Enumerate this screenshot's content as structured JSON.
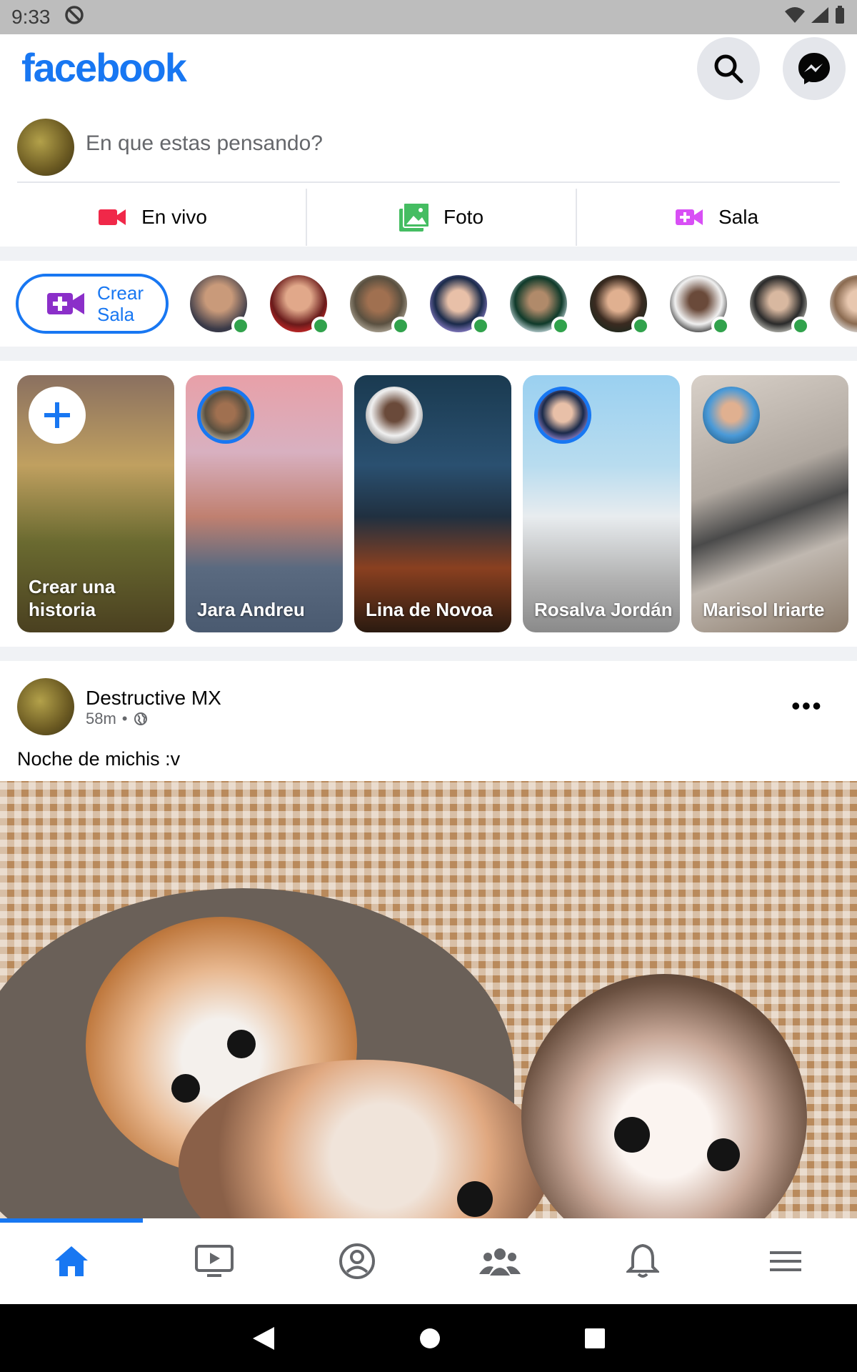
{
  "status_bar": {
    "time": "9:33"
  },
  "header": {
    "logo": "facebook"
  },
  "composer": {
    "placeholder": "En que estas pensando?",
    "actions": [
      {
        "label": "En vivo",
        "icon": "live-video-icon",
        "color": "#f02849"
      },
      {
        "label": "Foto",
        "icon": "photo-icon",
        "color": "#45bd62"
      },
      {
        "label": "Sala",
        "icon": "room-icon",
        "color": "#d84ff5"
      }
    ]
  },
  "rooms": {
    "create_label_line1": "Crear",
    "create_label_line2": "Sala"
  },
  "stories": [
    {
      "name": "Crear una historia"
    },
    {
      "name": "Jara Andreu"
    },
    {
      "name": "Lina de Novoa"
    },
    {
      "name": "Rosalva Jordán"
    },
    {
      "name": "Marisol Iriarte"
    }
  ],
  "post": {
    "author": "Destructive MX",
    "time": "58m",
    "text": "Noche de michis :v"
  },
  "colors": {
    "brand": "#1877f2",
    "online": "#31a24c"
  }
}
